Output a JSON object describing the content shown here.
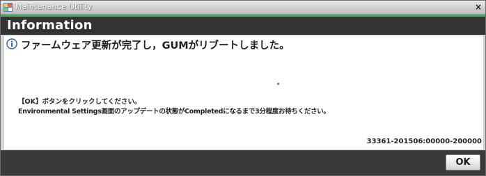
{
  "window": {
    "title": "Maintenance Utility",
    "close_glyph": "×",
    "icon": "app-icon"
  },
  "dialog": {
    "header": "Information",
    "headline": "ファームウェア更新が完了し，GUMがリブートしました。",
    "instruction_line_1": "【OK】ボタンをクリックしてください。",
    "instruction_line_2": "Environmental Settings画面のアップデートの状態がCompletedになるまで3分程度お待ちください。",
    "message_code": "33361-201506:00000-200000",
    "ok_label": "OK",
    "icon": "info-icon"
  },
  "colors": {
    "header_bg": "#333333",
    "accent_green": "#2fb84a",
    "footer_bg": "#3a3a3a"
  }
}
